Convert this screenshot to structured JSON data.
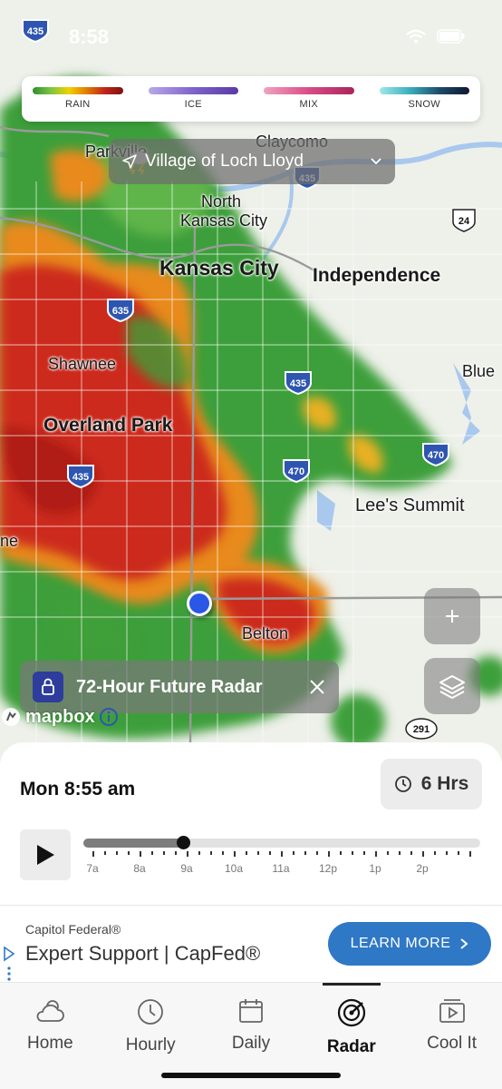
{
  "status": {
    "time": "8:58"
  },
  "legend": [
    {
      "label": "RAIN",
      "gradient": "linear-gradient(90deg,#2f8f2f,#7cc443,#f0d200,#e07a00,#c0231b,#7a1410)"
    },
    {
      "label": "ICE",
      "gradient": "linear-gradient(90deg,#b8a7e8,#7e63c9,#5a3aa6)"
    },
    {
      "label": "MIX",
      "gradient": "linear-gradient(90deg,#f0a2c0,#d84c86,#a8265a)"
    },
    {
      "label": "SNOW",
      "gradient": "linear-gradient(90deg,#9fe8ea,#3ab0bd,#1e4a6a,#101830)"
    }
  ],
  "location": {
    "label": "Village of Loch Lloyd"
  },
  "map_labels": [
    {
      "name": "Claycomo"
    },
    {
      "name": "Parkville"
    },
    {
      "name": "North"
    },
    {
      "name": "Kansas City"
    },
    {
      "name": "Kansas City"
    },
    {
      "name": "Independence"
    },
    {
      "name": "Shawnee"
    },
    {
      "name": "Overland Park"
    },
    {
      "name": "Blue"
    },
    {
      "name": "Lee's Summit"
    },
    {
      "name": "Belton"
    },
    {
      "name": "ne"
    }
  ],
  "shields": [
    "435",
    "435",
    "635",
    "435",
    "435",
    "470",
    "470",
    "24",
    "291"
  ],
  "future_radar": {
    "label": "72-Hour Future Radar"
  },
  "attribution": {
    "label": "mapbox"
  },
  "player": {
    "time_label": "Mon 8:55 am",
    "hours_label": "6 Hrs",
    "progress": 0.25,
    "tick_labels": [
      "7a",
      "8a",
      "9a",
      "10a",
      "11a",
      "12p",
      "1p",
      "2p"
    ]
  },
  "ad": {
    "sponsor": "Capitol Federal®",
    "title": "Expert Support | CapFed®",
    "button": "LEARN MORE",
    "accent": "#2f78c6"
  },
  "tabs": [
    {
      "label": "Home",
      "icon": "cloud-sun-icon",
      "active": false
    },
    {
      "label": "Hourly",
      "icon": "clock-icon",
      "active": false
    },
    {
      "label": "Daily",
      "icon": "calendar-icon",
      "active": false
    },
    {
      "label": "Radar",
      "icon": "radar-icon",
      "active": true
    },
    {
      "label": "Cool It",
      "icon": "video-icon",
      "active": false
    }
  ]
}
